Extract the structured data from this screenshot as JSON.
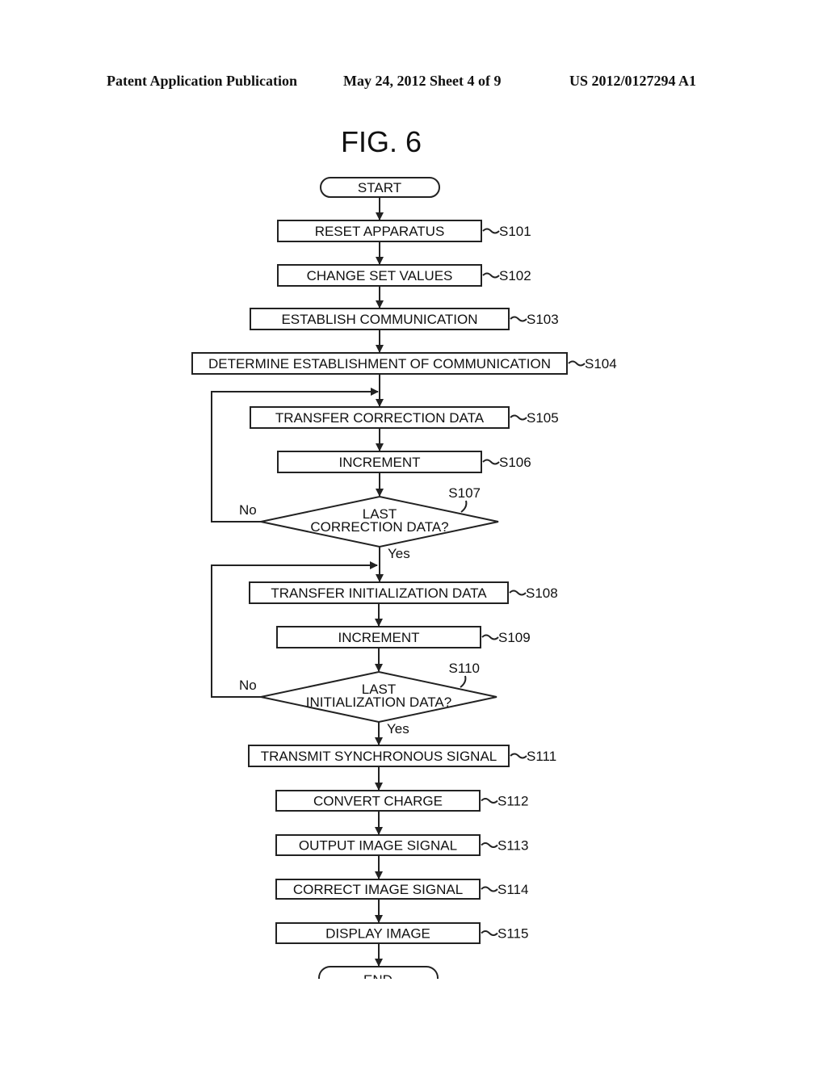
{
  "header": {
    "publication": "Patent Application Publication",
    "date_sheet": "May 24, 2012  Sheet 4 of 9",
    "number": "US 2012/0127294 A1"
  },
  "figure": {
    "title": "FIG.  6"
  },
  "flow": {
    "start": "START",
    "end": "END",
    "steps": [
      {
        "id": "S101",
        "label": "RESET APPARATUS"
      },
      {
        "id": "S102",
        "label": "CHANGE SET VALUES"
      },
      {
        "id": "S103",
        "label": "ESTABLISH COMMUNICATION"
      },
      {
        "id": "S104",
        "label": "DETERMINE ESTABLISHMENT OF COMMUNICATION"
      },
      {
        "id": "S105",
        "label": "TRANSFER CORRECTION DATA"
      },
      {
        "id": "S106",
        "label": "INCREMENT"
      },
      {
        "id": "S108",
        "label": "TRANSFER INITIALIZATION DATA"
      },
      {
        "id": "S109",
        "label": "INCREMENT"
      },
      {
        "id": "S111",
        "label": "TRANSMIT SYNCHRONOUS SIGNAL"
      },
      {
        "id": "S112",
        "label": "CONVERT CHARGE"
      },
      {
        "id": "S113",
        "label": "OUTPUT IMAGE SIGNAL"
      },
      {
        "id": "S114",
        "label": "CORRECT IMAGE SIGNAL"
      },
      {
        "id": "S115",
        "label": "DISPLAY IMAGE"
      }
    ],
    "decisions": [
      {
        "id": "S107",
        "line1": "LAST",
        "line2": "CORRECTION DATA?",
        "no": "No",
        "yes": "Yes"
      },
      {
        "id": "S110",
        "line1": "LAST",
        "line2": "INITIALIZATION DATA?",
        "no": "No",
        "yes": "Yes"
      }
    ]
  }
}
